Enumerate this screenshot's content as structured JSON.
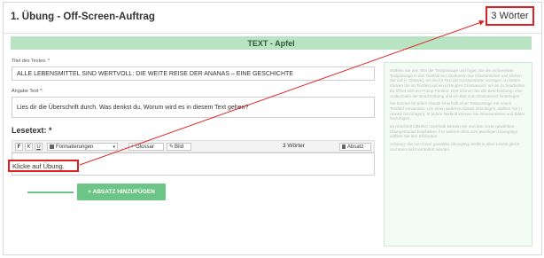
{
  "exercise": {
    "title": "1. Übung - Off-Screen-Auftrag",
    "word_count_badge": "3 Wörter"
  },
  "section_bar": {
    "label": "TEXT - Apfel"
  },
  "fields": {
    "title_label": "Titel des Textes: *",
    "title_value": "ALLE LEBENSMITTEL SIND WERTVOLL: DIE WEITE REISE DER ANANAS – EINE GESCHICHTE",
    "instruction_label": "Angabe Text *:",
    "instruction_value": "Lies dir die Überschrift durch. Was denkst du, Worum wird es in diesem Text gehen?"
  },
  "lesetext": {
    "label": "Lesetext: *",
    "toolbar": {
      "bold": "F",
      "italic": "K",
      "underline": "U",
      "formatting": "Formatierungen",
      "glossary": "+ Glossar",
      "image": "Bild",
      "word_count": "3 Wörter",
      "paragraph": "Absatz"
    },
    "editor_value": "Klicke auf Übung."
  },
  "add_paragraph_button": "+ ABSATZ HINZUFÜGEN",
  "help_text": [
    "Wählen Sie den Titel der Textpassage und fügen Sie die vorbereitete Textpassage in das Textfeld ein. Markieren Sie Glossarwörter und klicken Sie auf [+ Glossar], um sie im Text als Glossarwörter anzeigen zu lassen. Klicken Sie im Textfeld auf ein erzeugtes Glossarwort, um es zu bearbeiten. Es öffnet sich ein Popup-Fenster. Dort können Sie die Beschreibung, eine Audio-Datei der Beschreibung und ein Bild zum Glossarwort hinterlegen.",
    "Sie können für jeden Absatz innerhalb einer Textpassage ein neues Textfeld verwenden. Um einen weiteren Absatz einzufügen, wählen Sie [+ Absatz hinzufügen]. In jedem Textfeld können Sie Glossarwörter und Bilder hinzufügen.",
    "Im Abschnitt ÜBUNG unterhalb können Sie nun den zuvor gewählten Übungsmodus bearbeiten. Für weitere Infos zum jeweiligen Übungstyp wählen Sie den Infobutton.",
    "Achtung: der von Ihnen gewählte Übungstyp bleibt in allen Levels gleich und kann nicht verändert werden."
  ],
  "colors": {
    "accent_green": "#6cc487",
    "bar_green": "#b8e4c4",
    "highlight_red": "#e02020"
  }
}
